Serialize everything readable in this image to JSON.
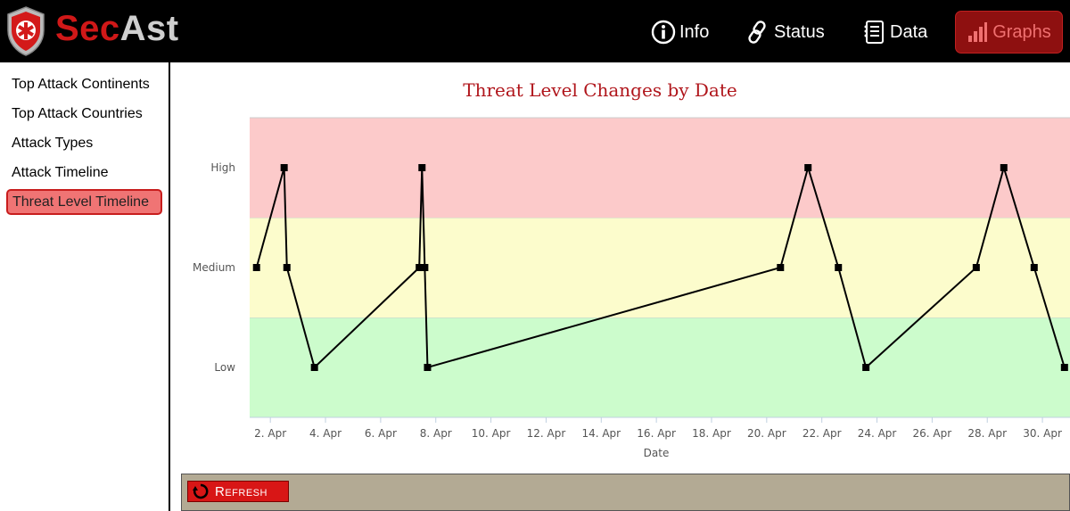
{
  "header": {
    "brand_sec": "Sec",
    "brand_ast": "Ast",
    "nav": {
      "info": "Info",
      "status": "Status",
      "data": "Data",
      "graphs": "Graphs"
    }
  },
  "sidebar": {
    "items": [
      {
        "label": "Top Attack Continents"
      },
      {
        "label": "Top Attack Countries"
      },
      {
        "label": "Attack Types"
      },
      {
        "label": "Attack Timeline"
      },
      {
        "label": "Threat Level Timeline"
      }
    ],
    "active_index": 4
  },
  "chart_data": {
    "type": "line",
    "title": "Threat Level Changes by Date",
    "xlabel": "Date",
    "ylabel": "",
    "y_categories": [
      "Low",
      "Medium",
      "High"
    ],
    "band_colors": {
      "Low": "#ccfccc",
      "Medium": "#fcfccc",
      "High": "#fccaca"
    },
    "line_color": "#000000",
    "x_ticks": [
      "2. Apr",
      "4. Apr",
      "6. Apr",
      "8. Apr",
      "10. Apr",
      "12. Apr",
      "14. Apr",
      "16. Apr",
      "18. Apr",
      "20. Apr",
      "22. Apr",
      "24. Apr",
      "26. Apr",
      "28. Apr",
      "30. Apr"
    ],
    "x_tick_days": [
      2,
      4,
      6,
      8,
      10,
      12,
      14,
      16,
      18,
      20,
      22,
      24,
      26,
      28,
      30
    ],
    "xlim_days": [
      1.25,
      31.0
    ],
    "points": [
      {
        "day": 1.5,
        "level": "Medium"
      },
      {
        "day": 2.5,
        "level": "High"
      },
      {
        "day": 2.6,
        "level": "Medium"
      },
      {
        "day": 3.6,
        "level": "Low"
      },
      {
        "day": 7.4,
        "level": "Medium"
      },
      {
        "day": 7.5,
        "level": "High"
      },
      {
        "day": 7.6,
        "level": "Medium"
      },
      {
        "day": 7.7,
        "level": "Low"
      },
      {
        "day": 20.5,
        "level": "Medium"
      },
      {
        "day": 21.5,
        "level": "High"
      },
      {
        "day": 22.6,
        "level": "Medium"
      },
      {
        "day": 23.6,
        "level": "Low"
      },
      {
        "day": 27.6,
        "level": "Medium"
      },
      {
        "day": 28.6,
        "level": "High"
      },
      {
        "day": 29.7,
        "level": "Medium"
      },
      {
        "day": 30.8,
        "level": "Low"
      }
    ]
  },
  "toolbar": {
    "refresh_label": "Refresh"
  }
}
